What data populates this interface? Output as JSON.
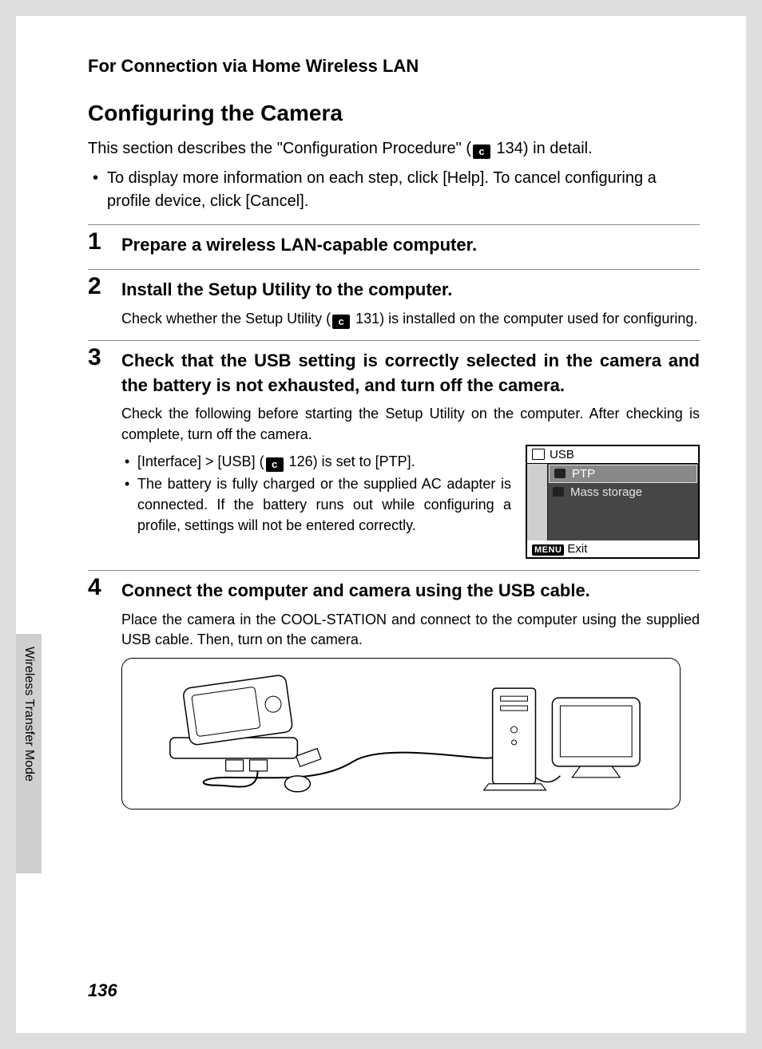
{
  "section_header": "For Connection via Home Wireless LAN",
  "title": "Configuring the Camera",
  "intro_line1_a": "This section describes the \"Configuration Procedure\" (",
  "intro_line1_b": " 134) in detail.",
  "intro_bullet": "To display more information on each step, click [Help]. To cancel configuring a profile device, click [Cancel].",
  "steps": {
    "s1": {
      "num": "1",
      "head": "Prepare a wireless LAN-capable computer."
    },
    "s2": {
      "num": "2",
      "head": "Install the Setup Utility to the computer.",
      "body_a": "Check whether the Setup Utility (",
      "body_b": " 131) is installed on the computer used for configuring."
    },
    "s3": {
      "num": "3",
      "head": "Check that the USB setting is correctly selected in the camera and the battery is not exhausted, and turn off the camera.",
      "body": "Check the following before starting the Setup Utility on the computer. After checking is complete, turn off the camera.",
      "bullet1_a": "[Interface] > [USB] (",
      "bullet1_b": " 126) is set to [PTP].",
      "bullet2": "The battery is fully charged or the supplied AC adapter is connected. If the battery runs out while configuring a profile, settings will not be entered correctly."
    },
    "s4": {
      "num": "4",
      "head": "Connect the computer and camera using the USB cable.",
      "body": "Place the camera in the COOL-STATION and connect to the computer using the supplied USB cable. Then, turn on the camera."
    }
  },
  "lcd": {
    "title": "USB",
    "item1": "PTP",
    "item2": "Mass storage",
    "menu_label": "MENU",
    "exit": "Exit"
  },
  "side_tab": "Wireless Transfer Mode",
  "page_number": "136",
  "book_icon_glyph": "c"
}
